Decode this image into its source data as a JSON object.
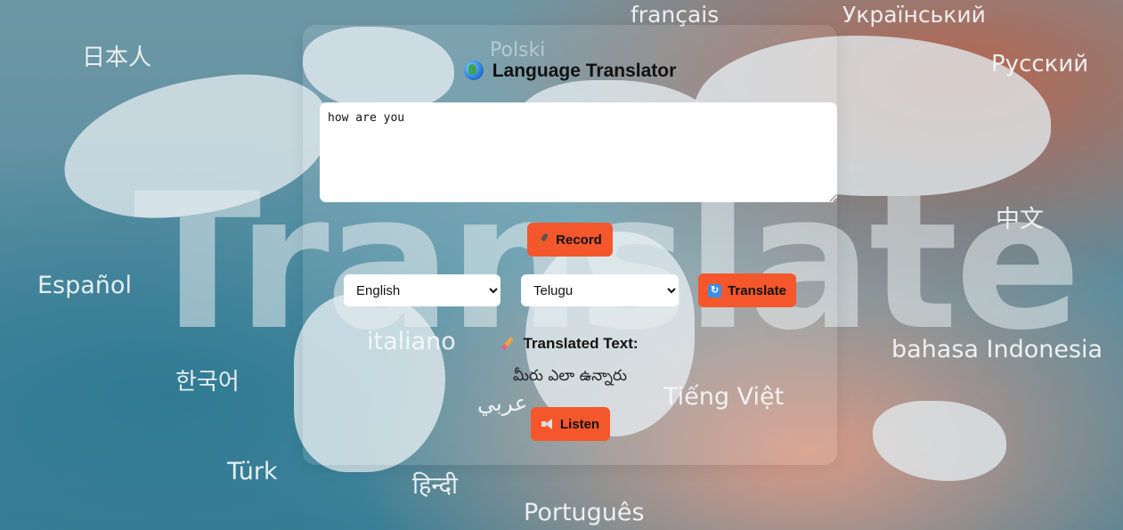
{
  "background": {
    "watermark": "Translate",
    "languages": [
      "français",
      "Український",
      "日本人",
      "Русский",
      "中文",
      "Español",
      "bahasa Indonesia",
      "italiano",
      "한국어",
      "Tiếng Việt",
      "عربي",
      "Türk",
      "हिन्दी",
      "Português",
      "Polski"
    ]
  },
  "app": {
    "title": "Language Translator",
    "input": {
      "value": "how are you"
    },
    "record_label": "Record",
    "source_language": {
      "selected": "English"
    },
    "target_language": {
      "selected": "Telugu"
    },
    "translate_label": "Translate",
    "output_heading": "Translated Text:",
    "output_text": "మీరు ఎలా ఉన్నారు",
    "listen_label": "Listen"
  },
  "colors": {
    "accent": "#f4572c"
  },
  "icons": {
    "title": "globe-icon",
    "record": "microphone-icon",
    "translate": "refresh-icon",
    "output": "pencil-icon",
    "listen": "speaker-icon"
  }
}
